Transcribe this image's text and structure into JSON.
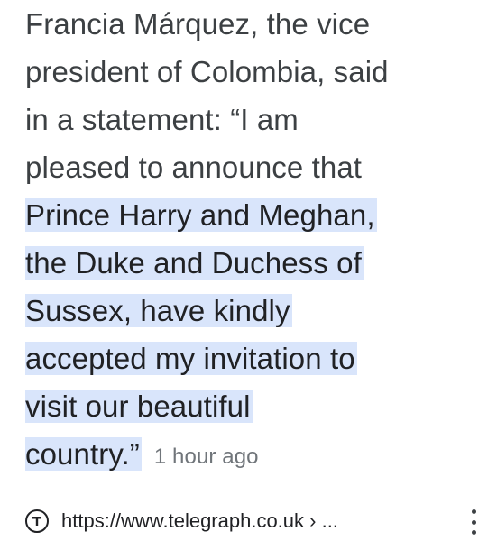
{
  "snippet": {
    "lines": [
      "Francia Márquez, the vice",
      "president of Colombia, said",
      "in a statement: “I am",
      "pleased to announce that",
      "Prince Harry and Meghan,",
      "the Duke and Duchess of",
      "Sussex, have kindly",
      "accepted my invitation to",
      "visit our beautiful",
      "country.”"
    ],
    "timestamp": "1 hour ago",
    "highlight_color": "#d9e5fb"
  },
  "source": {
    "favicon": "telegraph-logo-icon",
    "url": "https://www.telegraph.co.uk › ..."
  },
  "menu": {
    "icon": "more-vert-icon"
  }
}
